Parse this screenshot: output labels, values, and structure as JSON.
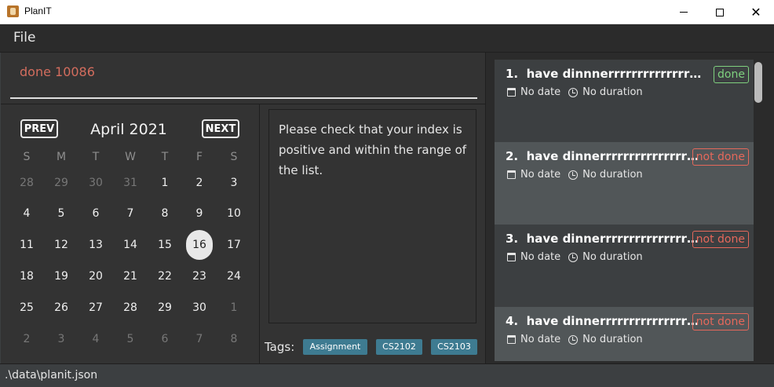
{
  "window": {
    "title": "PlanIT"
  },
  "menu": {
    "file": "File"
  },
  "command": {
    "text": "done 10086"
  },
  "calendar": {
    "prev": "PREV",
    "next": "NEXT",
    "month": "April 2021",
    "days_of_week": [
      "S",
      "M",
      "T",
      "W",
      "T",
      "F",
      "S"
    ],
    "weeks": [
      [
        "28",
        "29",
        "30",
        "31",
        "1",
        "2",
        "3"
      ],
      [
        "4",
        "5",
        "6",
        "7",
        "8",
        "9",
        "10"
      ],
      [
        "11",
        "12",
        "13",
        "14",
        "15",
        "16",
        "17"
      ],
      [
        "18",
        "19",
        "20",
        "21",
        "22",
        "23",
        "24"
      ],
      [
        "25",
        "26",
        "27",
        "28",
        "29",
        "30",
        "1"
      ],
      [
        "2",
        "3",
        "4",
        "5",
        "6",
        "7",
        "8"
      ]
    ],
    "today": "16"
  },
  "result": {
    "text": "Please check that your index is positive and within the range of the list."
  },
  "tags": {
    "label": "Tags:",
    "items": [
      "Assignment",
      "CS2102",
      "CS2103"
    ]
  },
  "tasks": [
    {
      "index": "1.",
      "name": "have dinnnerrrrrrrrrrrrrrrrrrrrrrrr...",
      "status": "done",
      "date": "No date",
      "duration": "No duration"
    },
    {
      "index": "2.",
      "name": "have dinnerrrrrrrrrrrrrrrrrrrrr...",
      "status": "not done",
      "date": "No date",
      "duration": "No duration"
    },
    {
      "index": "3.",
      "name": "have dinnerrrrrrrrrrrrrrrrrrrrr...",
      "status": "not done",
      "date": "No date",
      "duration": "No duration"
    },
    {
      "index": "4.",
      "name": "have dinnerrrrrrrrrrrrrrrrrrrrr...",
      "status": "not done",
      "date": "No date",
      "duration": "No duration"
    }
  ],
  "statusbar": {
    "path": ".\\data\\planit.json"
  },
  "colors": {
    "done": "#7fd17f",
    "not_done": "#e5685b",
    "tag": "#3e7b91",
    "command_text": "#d36d5e"
  }
}
